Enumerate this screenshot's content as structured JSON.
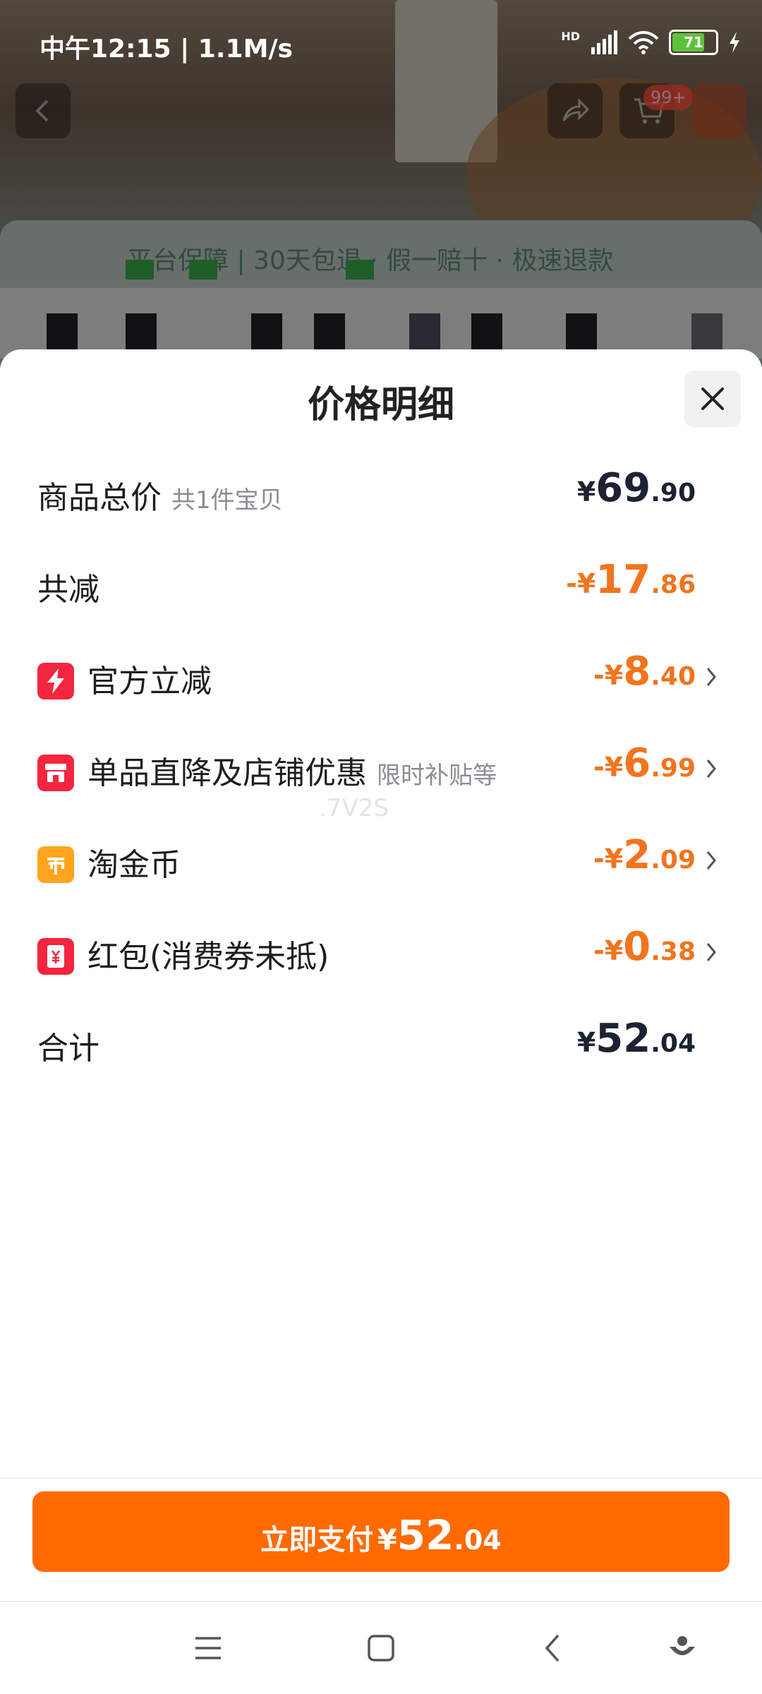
{
  "status_bar": {
    "time": "中午12:15 | 1.1M/s",
    "network_badge": "HD",
    "battery_level": "71",
    "icons": [
      "signal-icon",
      "wifi-icon",
      "battery-icon",
      "charging-icon"
    ]
  },
  "background": {
    "cart_badge": "99+",
    "guarantee_text": "平台保障 | 30天包退 · 假一赔十 · 极速退款"
  },
  "sheet": {
    "title": "价格明细",
    "rows": [
      {
        "label": "商品总价",
        "sub": "共1件宝贝",
        "currency": "¥",
        "int": "69",
        "dec": ".90",
        "color": "#1c2233"
      },
      {
        "label": "共减",
        "sub": "",
        "currency": "-¥",
        "int": "17",
        "dec": ".86",
        "color": "#f2741e"
      },
      {
        "label": "官方立减",
        "sub": "",
        "currency": "-¥",
        "int": "8",
        "dec": ".40",
        "icon": "lightning-icon",
        "icon_color": "#f3253f"
      },
      {
        "label": "单品直降及店铺优惠",
        "sub": "限时补贴等",
        "currency": "-¥",
        "int": "6",
        "dec": ".99",
        "icon": "shop-icon",
        "icon_color": "#f3253f"
      },
      {
        "label": "淘金币",
        "sub": "",
        "currency": "-¥",
        "int": "2",
        "dec": ".09",
        "icon": "coin-icon",
        "icon_color": "#ffa41c"
      },
      {
        "label": "红包(消费券未抵)",
        "sub": "",
        "currency": "-¥",
        "int": "0",
        "dec": ".38",
        "icon": "red-packet-icon",
        "icon_color": "#f3253f"
      },
      {
        "label": "合计",
        "sub": "",
        "currency": "¥",
        "int": "52",
        "dec": ".04",
        "color": "#1c2233"
      }
    ],
    "watermark": ".7V2S"
  },
  "footer": {
    "pay_label": "立即支付",
    "currency": "¥",
    "int": "52",
    "dec": ".04",
    "button_color": "#ff6a00"
  },
  "nav_bar": [
    "menu-icon",
    "home-icon",
    "back-icon",
    "assistant-icon"
  ]
}
